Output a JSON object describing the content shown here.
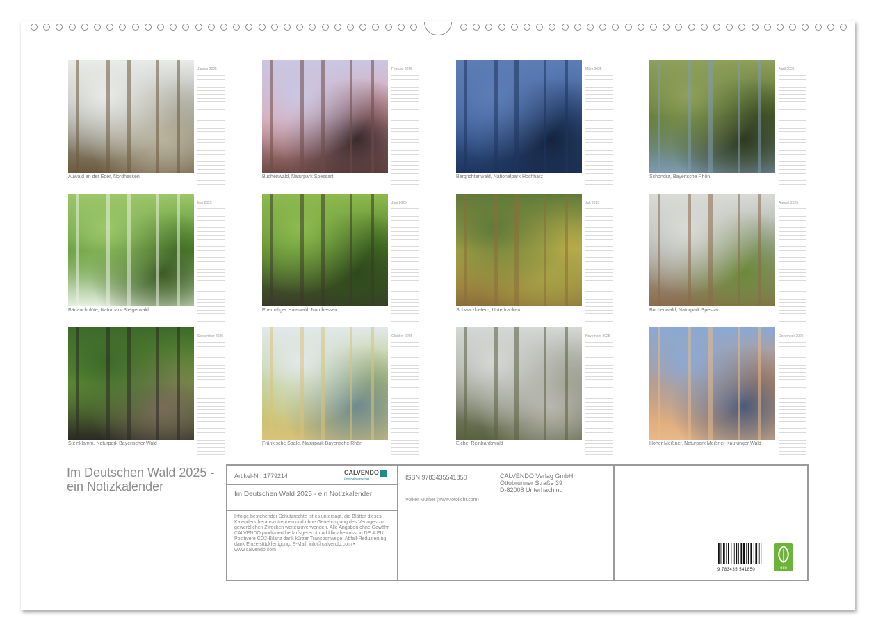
{
  "months": [
    {
      "name": "Januar 2025",
      "caption": "Auwald an der Eder, Nordhessen",
      "colors": [
        "#e9ebe8",
        "#9fa39a",
        "#6b5a3e",
        "#b9b29c"
      ]
    },
    {
      "name": "Februar 2025",
      "caption": "Buchenwald, Naturpark Spessart",
      "colors": [
        "#c9c7e3",
        "#e2a2a8",
        "#6d4a47",
        "#3b2a2c"
      ]
    },
    {
      "name": "März 2025",
      "caption": "Bergfichtenwald, Nationalpark Hochharz",
      "colors": [
        "#5d7db5",
        "#3c5e99",
        "#1e355e",
        "#14243f"
      ]
    },
    {
      "name": "April 2025",
      "caption": "Schondra, Bayerische Rhön",
      "colors": [
        "#8ea05a",
        "#4e6a2c",
        "#7f9ab1",
        "#2f3a20"
      ]
    },
    {
      "name": "Mai 2025",
      "caption": "Bärlauchblüte, Naturpark Steigerwald",
      "colors": [
        "#9cc76a",
        "#4f8a2c",
        "#e8f0e0",
        "#3c5c25"
      ]
    },
    {
      "name": "Juni 2025",
      "caption": "Ehemaliger Hutewald, Nordhessen",
      "colors": [
        "#8dbb4f",
        "#4d7a25",
        "#3a3a2a",
        "#2e4a1c"
      ]
    },
    {
      "name": "Juli 2025",
      "caption": "Schwarzkiefern, Unterfranken",
      "colors": [
        "#5f7a3a",
        "#c4b24a",
        "#8a6d3a",
        "#a5a246"
      ]
    },
    {
      "name": "August 2025",
      "caption": "Buchenwald, Naturpark Spessart",
      "colors": [
        "#d9dbd6",
        "#a4a7a0",
        "#8b6a4a",
        "#6b8a3a"
      ]
    },
    {
      "name": "September 2025",
      "caption": "Steinklamm, Naturpark Bayerischer Wald",
      "colors": [
        "#3d6a2a",
        "#6f9a3a",
        "#2a2a22",
        "#7a6b5a"
      ]
    },
    {
      "name": "Oktober 2025",
      "caption": "Fränkische Saale, Naturpark Bayerische Rhön",
      "colors": [
        "#e1e9ec",
        "#b4c36b",
        "#d9c27a",
        "#6f8a8f"
      ]
    },
    {
      "name": "November 2025",
      "caption": "Eiche, Reinhardswald",
      "colors": [
        "#d6d8d6",
        "#8b8f7d",
        "#5a6140",
        "#b9b8b0"
      ]
    },
    {
      "name": "Dezember 2025",
      "caption": "Hoher Meißner, Naturpark Meißner-Kaufunger Wald",
      "colors": [
        "#89a9d6",
        "#d8965e",
        "#e7b98a",
        "#4b5a7a"
      ]
    }
  ],
  "title": "Im Deutschen Wald 2025 - ein Notizkalender",
  "info": {
    "article": "Artikel-Nr. 1779214",
    "logo": "CALVENDO",
    "logo_sub": "Dein Kalenderverlag",
    "panel_title": "Im Deutschen Wald 2025 - ein Notizkalender",
    "legal": "Infolge bestehender Schutzrechte ist es untersagt, die Blätter dieses Kalenders herauszutrennen und ohne Genehmigung des Verlages zu gewerblichen Zwecken weiterzuverwenden. Alle Angaben ohne Gewähr. CALVENDO produziert bedarfsgerecht und klimabewusst in DE & EU. Positivere CO2-Bilanz dank kürzer Transportwege, Abfall-Reduzierung dank Einzelstückfertigung. E-Mail: info@calvendo.com • www.calvendo.com",
    "isbn": "ISBN 9783435541850",
    "author": "Volker Müther (www.fotolicht.com)",
    "publisher_lines": [
      "CALVENDO Verlag GmbH",
      "Ottobrunner Straße 39",
      "D-82008 Unterhaching"
    ],
    "barcode_digits": "9 783435 541850",
    "eco_label": "eco"
  }
}
